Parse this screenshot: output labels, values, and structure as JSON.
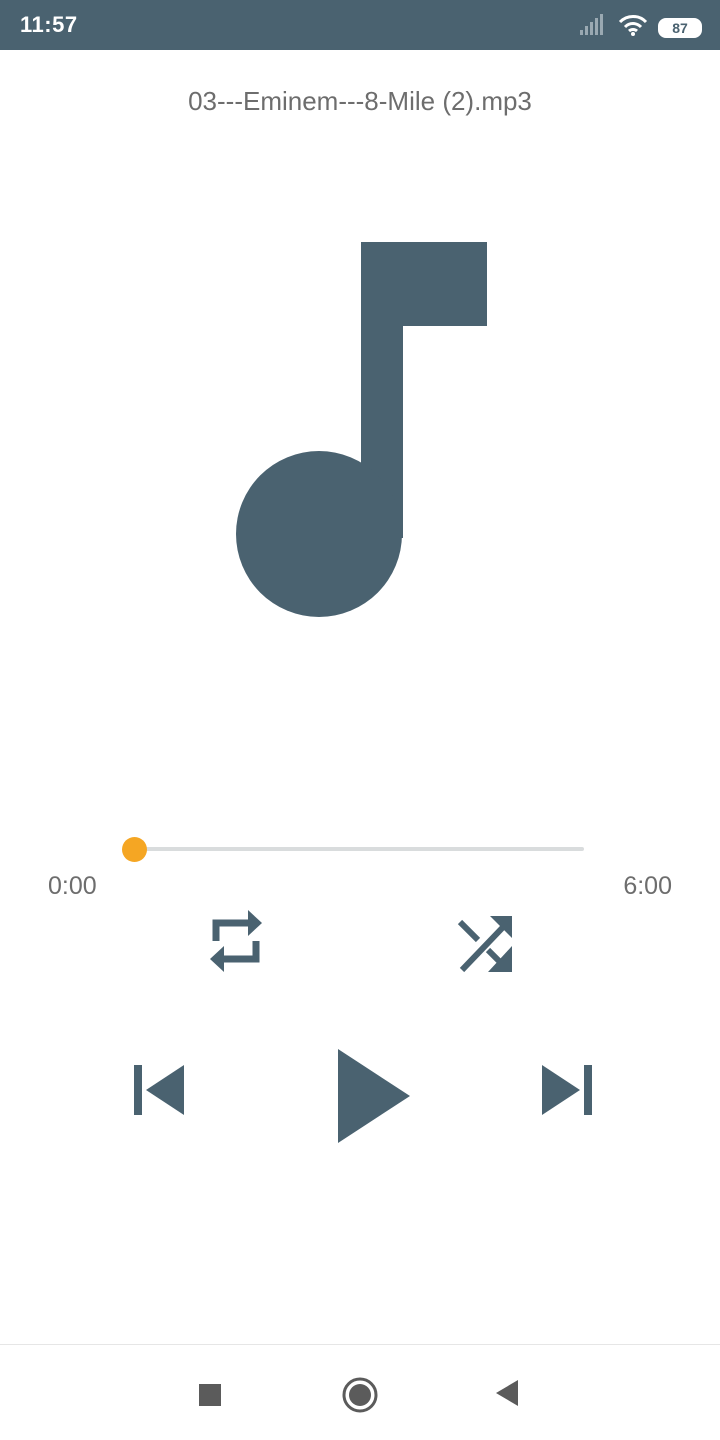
{
  "status_bar": {
    "time": "11:57",
    "battery_level": "87",
    "icons": [
      "signal-icon",
      "wifi-icon",
      "battery-icon"
    ]
  },
  "player": {
    "track_title": "03---Eminem---8-Mile (2).mp3",
    "album_art_icon": "music-note-icon",
    "progress_fraction": 0.0,
    "elapsed_time": "0:00",
    "total_time": "6:00",
    "controls": [
      "repeat-icon",
      "shuffle-icon",
      "skip-previous-icon",
      "play-icon",
      "skip-next-icon"
    ]
  },
  "nav_bar": {
    "buttons": [
      "recents-icon",
      "home-icon",
      "back-icon"
    ]
  },
  "colors": {
    "primary": "#4a6270",
    "accent": "#f5a623",
    "text_secondary": "#6d6d6d",
    "track": "#d9dcdd"
  }
}
